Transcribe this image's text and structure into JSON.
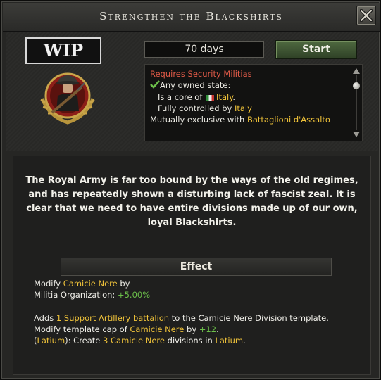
{
  "window": {
    "title": "Strengthen the Blackshirts",
    "close_icon": "close-x-icon"
  },
  "badge": {
    "wip_label": "WIP",
    "emblem_icon": "blackshirt-soldier-emblem-icon"
  },
  "focus": {
    "days": "70 days",
    "start_label": "Start"
  },
  "requirements": {
    "line1": "Requires Security Militias",
    "line2_check_icon": "checkmark-icon",
    "line2": "Any owned state:",
    "line3_prefix": "Is a core of ",
    "line3_flag_icon": "italy-flag-icon",
    "line3_country": "Italy",
    "line3_suffix": ".",
    "line4_prefix": "Fully controlled by ",
    "line4_country": "Italy",
    "line5_prefix": "Mutually exclusive with ",
    "line5_focus": "Battaglioni d'Assalto"
  },
  "description": "The Royal Army is far too bound by the ways of the old regimes, and has repeatedly shown a disturbing lack of fascist zeal. It is clear that we need to have entire divisions made up of our own, loyal Blackshirts.",
  "effect": {
    "header": "Effect",
    "e1_prefix": "Modify ",
    "e1_name": "Camicie Nere",
    "e1_suffix": " by",
    "e2_label": "Militia Organization: ",
    "e2_value": "+5.00%",
    "e3_prefix": "Adds ",
    "e3_item": "1 Support Artillery battalion",
    "e3_suffix": " to the Camicie Nere Division template.",
    "e4_prefix": "Modify template cap of ",
    "e4_name": "Camicie Nere",
    "e4_mid": " by ",
    "e4_value": "+12",
    "e4_suffix": ".",
    "e5_open": "(",
    "e5_state": "Latium",
    "e5_mid": "): Create ",
    "e5_item": "3 Camicie Nere",
    "e5_mid2": " divisions in ",
    "e5_state2": "Latium",
    "e5_end": "."
  },
  "colors": {
    "requirement_red": "#e25b48",
    "highlight_yellow": "#f0c33a",
    "positive_green": "#6cc04a"
  }
}
